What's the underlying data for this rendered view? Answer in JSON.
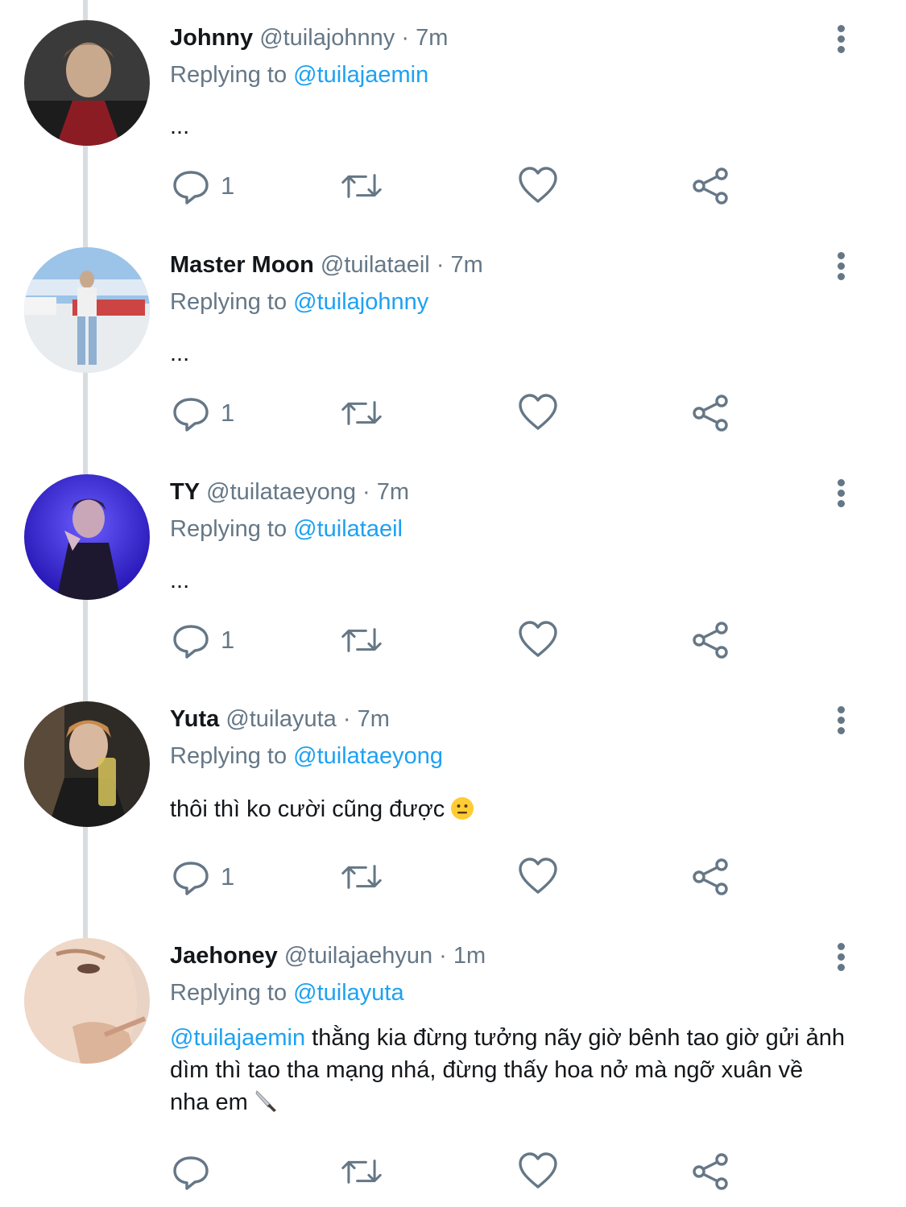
{
  "tweets": [
    {
      "name": "Johnny",
      "handle": "@tuilajohnny",
      "separator": "·",
      "time": "7m",
      "replying_label": "Replying to",
      "replying_to": "@tuilajaemin",
      "text": "...",
      "reply_count": "1"
    },
    {
      "name": "Master Moon",
      "handle": "@tuilataeil",
      "separator": "·",
      "time": "7m",
      "replying_label": "Replying to",
      "replying_to": "@tuilajohnny",
      "text": "...",
      "reply_count": "1"
    },
    {
      "name": "TY",
      "handle": "@tuilataeyong",
      "separator": "·",
      "time": "7m",
      "replying_label": "Replying to",
      "replying_to": "@tuilataeil",
      "text": "...",
      "reply_count": "1"
    },
    {
      "name": "Yuta",
      "handle": "@tuilayuta",
      "separator": "·",
      "time": "7m",
      "replying_label": "Replying to",
      "replying_to": "@tuilataeyong",
      "text": "thôi thì ko cười cũng được",
      "emoji": "neutral-face-emoji",
      "reply_count": "1"
    },
    {
      "name": "Jaehoney",
      "handle": "@tuilajaehyun",
      "separator": "·",
      "time": "1m",
      "replying_label": "Replying to",
      "replying_to": "@tuilayuta",
      "mention": "@tuilajaemin",
      "text": " thằng kia đừng tưởng nãy giờ bênh tao giờ gửi ảnh dìm thì tao tha mạng nhá, đừng thấy hoa nở mà ngỡ xuân về nha em",
      "emoji": "knife-emoji",
      "reply_count": ""
    }
  ],
  "icons": {
    "reply": "reply-bubble-icon",
    "retweet": "retweet-icon",
    "like": "heart-icon",
    "share": "share-icon",
    "more": "more-vertical-icon"
  },
  "colors": {
    "accent": "#1da1f2",
    "muted": "#657786",
    "text": "#14171a",
    "thread_line": "#d8dde1"
  }
}
